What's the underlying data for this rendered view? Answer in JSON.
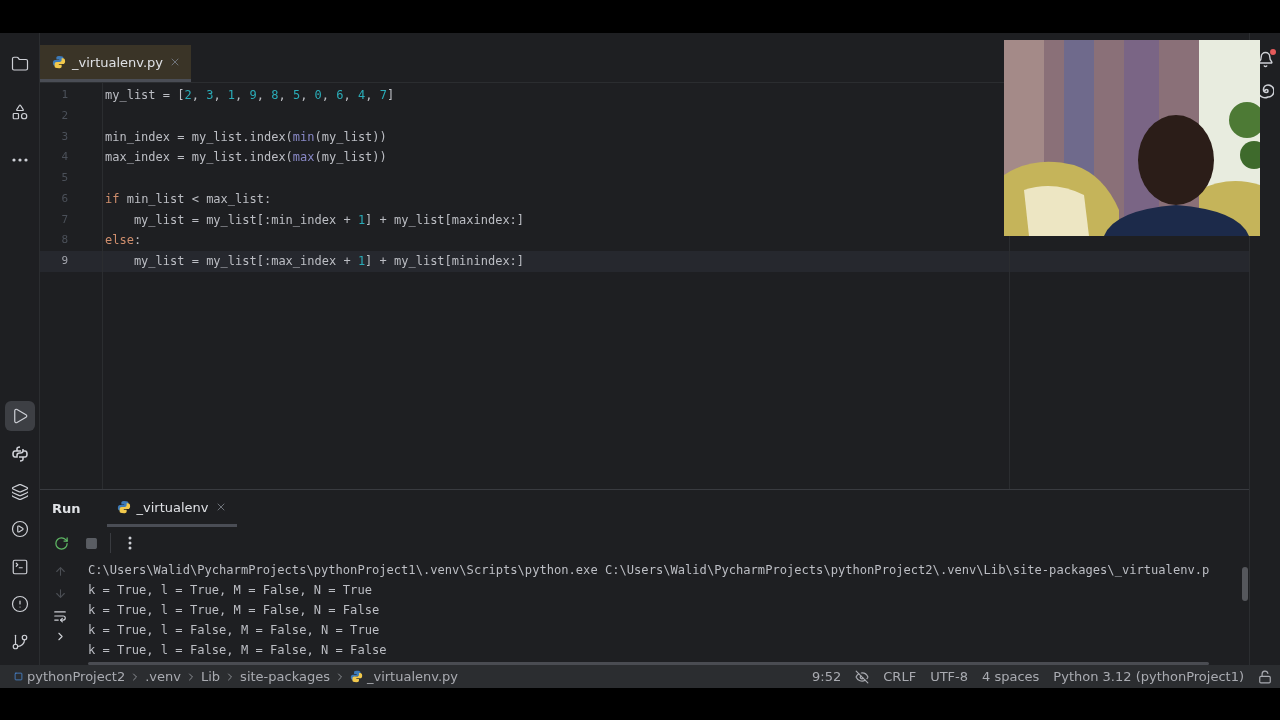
{
  "sidebar": {
    "top_tools": [
      {
        "selected": false
      },
      {
        "selected": false
      },
      {
        "selected": false
      }
    ],
    "bottom_tools": [
      {
        "selected": true
      },
      {
        "selected": false
      },
      {
        "selected": false
      },
      {
        "selected": false
      },
      {
        "selected": false
      },
      {
        "selected": false
      },
      {
        "selected": false
      }
    ]
  },
  "editor": {
    "tabs": [
      {
        "label": "_virtualenv.py",
        "selected": true
      }
    ],
    "lines": [
      {
        "number": "1",
        "current": false,
        "tokens": [
          {
            "kind": "plain",
            "text": "my_list = ["
          },
          {
            "kind": "number",
            "text": "2"
          },
          {
            "kind": "plain",
            "text": ", "
          },
          {
            "kind": "number",
            "text": "3"
          },
          {
            "kind": "plain",
            "text": ", "
          },
          {
            "kind": "number",
            "text": "1"
          },
          {
            "kind": "plain",
            "text": ", "
          },
          {
            "kind": "number",
            "text": "9"
          },
          {
            "kind": "plain",
            "text": ", "
          },
          {
            "kind": "number",
            "text": "8"
          },
          {
            "kind": "plain",
            "text": ", "
          },
          {
            "kind": "number",
            "text": "5"
          },
          {
            "kind": "plain",
            "text": ", "
          },
          {
            "kind": "number",
            "text": "0"
          },
          {
            "kind": "plain",
            "text": ", "
          },
          {
            "kind": "number",
            "text": "6"
          },
          {
            "kind": "plain",
            "text": ", "
          },
          {
            "kind": "number",
            "text": "4"
          },
          {
            "kind": "plain",
            "text": ", "
          },
          {
            "kind": "number",
            "text": "7"
          },
          {
            "kind": "plain",
            "text": "]"
          }
        ]
      },
      {
        "number": "2",
        "current": false
      },
      {
        "number": "3",
        "current": false,
        "tokens": [
          {
            "kind": "plain",
            "text": "min_index = my_list.index("
          },
          {
            "kind": "builtin",
            "text": "min"
          },
          {
            "kind": "plain",
            "text": "(my_list))"
          }
        ]
      },
      {
        "number": "4",
        "current": false,
        "tokens": [
          {
            "kind": "plain",
            "text": "max_index = my_list.index("
          },
          {
            "kind": "builtin",
            "text": "max"
          },
          {
            "kind": "plain",
            "text": "(my_list))"
          }
        ]
      },
      {
        "number": "5",
        "current": false
      },
      {
        "number": "6",
        "current": false,
        "tokens": [
          {
            "kind": "keyword",
            "text": "if"
          },
          {
            "kind": "plain",
            "text": " min_list < max_list:"
          }
        ]
      },
      {
        "number": "7",
        "current": false,
        "tokens": [
          {
            "kind": "plain",
            "text": "    my_list = my_list[:min_index + "
          },
          {
            "kind": "number",
            "text": "1"
          },
          {
            "kind": "plain",
            "text": "] + my_list[maxindex:]"
          }
        ]
      },
      {
        "number": "8",
        "current": false,
        "tokens": [
          {
            "kind": "keyword",
            "text": "else"
          },
          {
            "kind": "plain",
            "text": ":"
          }
        ]
      },
      {
        "number": "9",
        "current": true,
        "tokens": [
          {
            "kind": "plain",
            "text": "    my_list = my_list[:max_index + "
          },
          {
            "kind": "number",
            "text": "1"
          },
          {
            "kind": "plain",
            "text": "] + my_list[minindex:]"
          }
        ]
      }
    ]
  },
  "run_panel": {
    "title": "Run",
    "tabs": [
      {
        "label": "_virtualenv",
        "selected": true
      }
    ],
    "output": [
      "C:\\Users\\Walid\\PycharmProjects\\pythonProject1\\.venv\\Scripts\\python.exe C:\\Users\\Walid\\PycharmProjects\\pythonProject2\\.venv\\Lib\\site-packages\\_virtualenv.p",
      "k = True, l = True, M = False, N = True",
      "k = True, l = True, M = False, N = False",
      "k = True, l = False, M = False, N = True",
      "k = True, l = False, M = False, N = False"
    ]
  },
  "status_bar": {
    "breadcrumbs": [
      "pythonProject2",
      ".venv",
      "Lib",
      "site-packages",
      "_virtualenv.py"
    ],
    "items": [
      "9:52",
      "CRLF",
      "UTF-8",
      "4 spaces",
      "Python 3.12 (pythonProject1)"
    ]
  }
}
